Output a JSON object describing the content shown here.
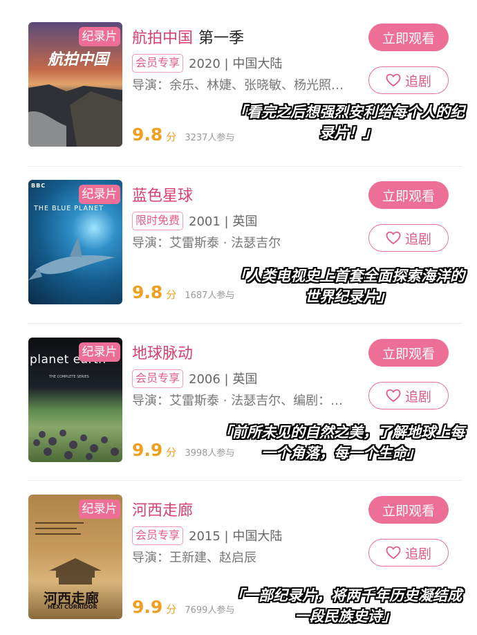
{
  "items": [
    {
      "category_tag": "纪录片",
      "title": "航拍中国",
      "season": "第一季",
      "badge": "会员专享",
      "year_region": "2020 | 中国大陆",
      "director": "导演：余乐、林婕、张晓敏、杨光照…",
      "score": "9.8",
      "score_unit": "分",
      "participants": "3237人参与",
      "watch_label": "立即观看",
      "follow_label": "追剧",
      "quote_line1": "「看完之后想强烈安利给每个人的纪",
      "quote_line2": "录片！」",
      "poster_text": "航拍中国"
    },
    {
      "category_tag": "纪录片",
      "title": "蓝色星球",
      "season": "",
      "badge": "限时免费",
      "year_region": "2001 | 英国",
      "director": "导演：艾雷斯泰 · 法瑟吉尔",
      "score": "9.8",
      "score_unit": "分",
      "participants": "1687人参与",
      "watch_label": "立即观看",
      "follow_label": "追剧",
      "quote_line1": "「人类电视史上首套全面探索海洋的",
      "quote_line2": "世界纪录片」",
      "poster_text": "THE BLUE PLANET",
      "poster_sub": "BBC"
    },
    {
      "category_tag": "纪录片",
      "title": "地球脉动",
      "season": "",
      "badge": "会员专享",
      "year_region": "2006 | 英国",
      "director": "导演：艾雷斯泰 · 法瑟吉尔、编剧：…",
      "score": "9.9",
      "score_unit": "分",
      "participants": "3998人参与",
      "watch_label": "立即观看",
      "follow_label": "追剧",
      "quote_line1": "「前所未见的自然之美，了解地球上每",
      "quote_line2": "一个角落，每一个生命」",
      "poster_text": "planet earth",
      "poster_sub": "THE COMPLETE SERIES"
    },
    {
      "category_tag": "纪录片",
      "title": "河西走廊",
      "season": "",
      "badge": "会员专享",
      "year_region": "2015 | 中国大陆",
      "director": "导演：王新建、赵启辰",
      "score": "9.9",
      "score_unit": "分",
      "participants": "7699人参与",
      "watch_label": "立即观看",
      "follow_label": "追剧",
      "quote_line1": "「一部纪录片，将两千年历史凝结成",
      "quote_line2": "一段民族史诗」",
      "poster_text": "河西走廊",
      "poster_sub": "HEXI CORRIDOR"
    }
  ],
  "colors": {
    "accent": "#ee6f95",
    "title": "#d7406f",
    "score": "#f0a021"
  }
}
